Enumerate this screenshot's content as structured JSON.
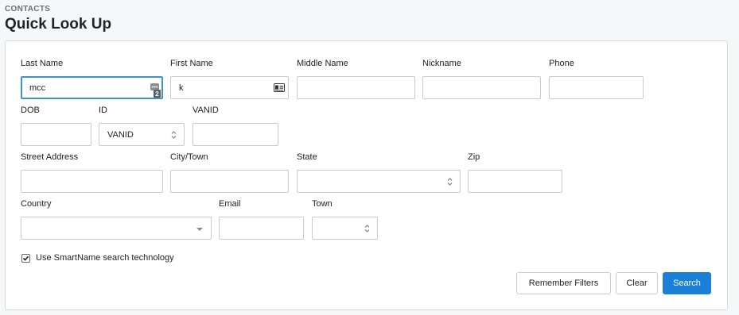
{
  "header": {
    "breadcrumb": "CONTACTS",
    "title": "Quick Look Up"
  },
  "fields": {
    "last_name": {
      "label": "Last Name",
      "value": "mcc",
      "badge": "2"
    },
    "first_name": {
      "label": "First Name",
      "value": "k"
    },
    "middle_name": {
      "label": "Middle Name",
      "value": ""
    },
    "nickname": {
      "label": "Nickname",
      "value": ""
    },
    "phone": {
      "label": "Phone",
      "value": ""
    },
    "dob": {
      "label": "DOB",
      "value": ""
    },
    "id": {
      "label": "ID",
      "value": "VANID"
    },
    "vanid": {
      "label": "VANID",
      "value": ""
    },
    "street_address": {
      "label": "Street Address",
      "value": ""
    },
    "city_town": {
      "label": "City/Town",
      "value": ""
    },
    "state": {
      "label": "State",
      "value": ""
    },
    "zip": {
      "label": "Zip",
      "value": ""
    },
    "country": {
      "label": "Country",
      "value": ""
    },
    "email": {
      "label": "Email",
      "value": ""
    },
    "town": {
      "label": "Town",
      "value": ""
    }
  },
  "smartname": {
    "label": "Use SmartName search technology",
    "checked": true
  },
  "buttons": {
    "remember": "Remember Filters",
    "clear": "Clear",
    "search": "Search"
  },
  "colors": {
    "accent": "#1a7fd8",
    "focus": "#3d8fd6"
  }
}
